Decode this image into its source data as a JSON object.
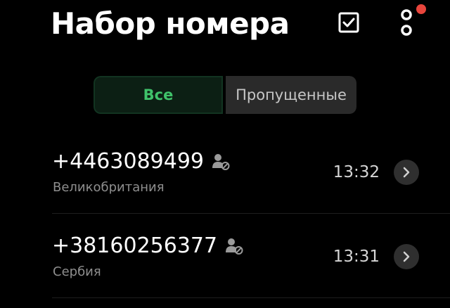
{
  "header": {
    "title": "Набор номера",
    "select_icon": "checkbox-select-icon",
    "more_icon": "more-vertical-icon",
    "has_notification": true
  },
  "tabs": [
    {
      "label": "Все",
      "selected": true
    },
    {
      "label": "Пропущенные",
      "selected": false
    }
  ],
  "calls": [
    {
      "number": "+4463089499",
      "country": "Великобритания",
      "time": "13:32"
    },
    {
      "number": "+38160256377",
      "country": "Сербия",
      "time": "13:31"
    }
  ],
  "colors": {
    "background": "#000000",
    "text_primary": "#ffffff",
    "text_secondary": "#8e8e8e",
    "tab_selected_bg": "#0c1f14",
    "tab_selected_text": "#3fc26a",
    "tab_unselected_bg": "#2a2a2a",
    "tab_unselected_text": "#c6c6c6",
    "icon_gray": "#9a9a9a",
    "detail_button_bg": "#2f2f2f",
    "divider": "#1e1e1e",
    "notification": "#e8453c"
  }
}
